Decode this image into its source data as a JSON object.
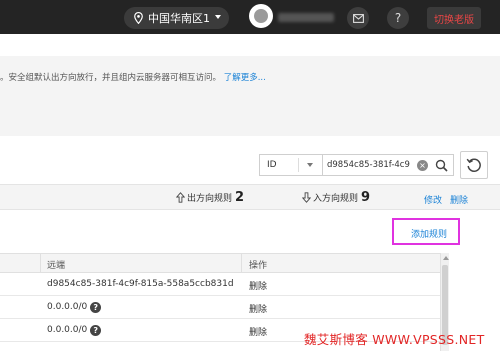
{
  "topbar": {
    "region_label": "中国华南区1",
    "switch_label": "切换老版"
  },
  "info": {
    "text": "。安全组默认出方向放行，并且组内云服务器可相互访问。",
    "link": "了解更多..."
  },
  "search": {
    "field_value": "ID",
    "query_value": "d9854c85-381f-4c9"
  },
  "group": {
    "outbound_label": "出方向规则",
    "outbound_count": "2",
    "inbound_label": "入方向规则",
    "inbound_count": "9",
    "edit_label": "修改",
    "delete_label": "删除"
  },
  "add_rule_label": "添加规则",
  "rules_table": {
    "headers": {
      "remote": "远端",
      "action": "操作"
    },
    "rows": [
      {
        "remote": "d9854c85-381f-4c9f-815a-558a5ccb831d",
        "action": "删除"
      },
      {
        "remote": "0.0.0.0/0",
        "action": "删除"
      },
      {
        "remote": "0.0.0.0/0",
        "action": "删除"
      }
    ]
  },
  "watermark": "魏艾斯博客 WWW.VPSSS.NET",
  "colors": {
    "topbar_bg": "#242424",
    "link": "#1a82d6",
    "highlight_border": "#e032e0",
    "switch_text": "#e84646",
    "watermark": "#e22626"
  },
  "icons": [
    "location-pin-icon",
    "chevron-down-icon",
    "mail-icon",
    "help-icon",
    "clear-icon",
    "search-icon",
    "refresh-icon",
    "arrow-up-icon",
    "arrow-down-icon"
  ]
}
